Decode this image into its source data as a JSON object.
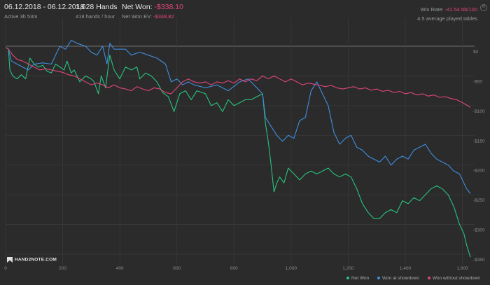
{
  "header": {
    "date_range": "06.12.2018 - 06.12.2018",
    "active": "Active 3h 53m",
    "hands": "1,628 Hands",
    "rate": "418 hands / hour",
    "net_won_label": "Net Won:",
    "net_won_value": "-$338.10",
    "net_won_ev_label": "Net Won  EV:",
    "net_won_ev_value": "-$348.82",
    "win_rate_label": "Win Rate:",
    "win_rate_value": "-41.54 bb/100",
    "tables": "4.5 average played tables"
  },
  "logo": "HAND2NOTE.COM",
  "colors": {
    "net_won": "#27c47f",
    "showdown": "#3f8fe0",
    "non_showdown": "#e0457a",
    "grid": "#3a3a3a",
    "zero": "#8a8a8a"
  },
  "chart_data": {
    "type": "line",
    "title": "",
    "xlabel": "",
    "ylabel": "",
    "xlim": [
      0,
      1628
    ],
    "ylim": [
      -350,
      0
    ],
    "x_ticks": [
      0,
      200,
      400,
      600,
      800,
      1000,
      1200,
      1400,
      1600
    ],
    "x_tick_labels": [
      "0",
      "200",
      "400",
      "600",
      "800",
      "1,000",
      "1,200",
      "1,400",
      "1,600"
    ],
    "y_ticks": [
      0,
      -50,
      -100,
      -150,
      -200,
      -250,
      -300,
      -350
    ],
    "y_tick_labels": [
      "$0",
      "-$50",
      "-$100",
      "-$150",
      "-$200",
      "-$250",
      "-$300",
      "-$350"
    ],
    "legend_position": "bottom-right",
    "series": [
      {
        "name": "Net Won",
        "color_key": "net_won",
        "points": [
          [
            0,
            -2
          ],
          [
            10,
            -5
          ],
          [
            15,
            -40
          ],
          [
            25,
            -50
          ],
          [
            40,
            -55
          ],
          [
            55,
            -48
          ],
          [
            70,
            -55
          ],
          [
            85,
            -20
          ],
          [
            100,
            -30
          ],
          [
            115,
            -35
          ],
          [
            130,
            -32
          ],
          [
            145,
            -42
          ],
          [
            160,
            -45
          ],
          [
            175,
            -30
          ],
          [
            190,
            -35
          ],
          [
            205,
            -40
          ],
          [
            215,
            -25
          ],
          [
            230,
            -45
          ],
          [
            240,
            -40
          ],
          [
            260,
            -60
          ],
          [
            280,
            -50
          ],
          [
            300,
            -55
          ],
          [
            310,
            -60
          ],
          [
            325,
            -80
          ],
          [
            335,
            -50
          ],
          [
            350,
            -70
          ],
          [
            365,
            -15
          ],
          [
            380,
            -40
          ],
          [
            400,
            -55
          ],
          [
            420,
            -35
          ],
          [
            440,
            -40
          ],
          [
            460,
            -35
          ],
          [
            470,
            -55
          ],
          [
            490,
            -45
          ],
          [
            510,
            -50
          ],
          [
            530,
            -60
          ],
          [
            550,
            -78
          ],
          [
            570,
            -85
          ],
          [
            590,
            -110
          ],
          [
            610,
            -80
          ],
          [
            630,
            -75
          ],
          [
            650,
            -90
          ],
          [
            670,
            -75
          ],
          [
            700,
            -80
          ],
          [
            720,
            -100
          ],
          [
            740,
            -95
          ],
          [
            760,
            -110
          ],
          [
            780,
            -90
          ],
          [
            800,
            -100
          ],
          [
            820,
            -95
          ],
          [
            840,
            -90
          ],
          [
            860,
            -90
          ],
          [
            880,
            -85
          ],
          [
            900,
            -80
          ],
          [
            910,
            -130
          ],
          [
            920,
            -160
          ],
          [
            930,
            -200
          ],
          [
            940,
            -245
          ],
          [
            950,
            -230
          ],
          [
            960,
            -220
          ],
          [
            975,
            -230
          ],
          [
            990,
            -205
          ],
          [
            1010,
            -215
          ],
          [
            1030,
            -225
          ],
          [
            1050,
            -215
          ],
          [
            1070,
            -210
          ],
          [
            1090,
            -215
          ],
          [
            1110,
            -210
          ],
          [
            1130,
            -205
          ],
          [
            1150,
            -215
          ],
          [
            1170,
            -220
          ],
          [
            1190,
            -215
          ],
          [
            1210,
            -220
          ],
          [
            1230,
            -240
          ],
          [
            1250,
            -265
          ],
          [
            1270,
            -280
          ],
          [
            1290,
            -290
          ],
          [
            1310,
            -290
          ],
          [
            1330,
            -280
          ],
          [
            1350,
            -275
          ],
          [
            1370,
            -280
          ],
          [
            1390,
            -260
          ],
          [
            1410,
            -265
          ],
          [
            1430,
            -255
          ],
          [
            1450,
            -260
          ],
          [
            1470,
            -250
          ],
          [
            1490,
            -240
          ],
          [
            1510,
            -235
          ],
          [
            1530,
            -240
          ],
          [
            1550,
            -250
          ],
          [
            1570,
            -270
          ],
          [
            1590,
            -300
          ],
          [
            1605,
            -315
          ],
          [
            1615,
            -335
          ],
          [
            1628,
            -355
          ]
        ]
      },
      {
        "name": "Won at showdown",
        "color_key": "showdown",
        "points": [
          [
            0,
            -2
          ],
          [
            10,
            -5
          ],
          [
            20,
            -25
          ],
          [
            40,
            -30
          ],
          [
            60,
            -35
          ],
          [
            80,
            -40
          ],
          [
            100,
            -30
          ],
          [
            130,
            -28
          ],
          [
            160,
            -30
          ],
          [
            190,
            0
          ],
          [
            210,
            -5
          ],
          [
            230,
            10
          ],
          [
            250,
            5
          ],
          [
            280,
            0
          ],
          [
            300,
            -10
          ],
          [
            320,
            -15
          ],
          [
            340,
            0
          ],
          [
            355,
            -30
          ],
          [
            365,
            5
          ],
          [
            380,
            -5
          ],
          [
            420,
            -5
          ],
          [
            440,
            -15
          ],
          [
            470,
            -10
          ],
          [
            500,
            -15
          ],
          [
            530,
            -20
          ],
          [
            560,
            -30
          ],
          [
            580,
            -60
          ],
          [
            600,
            -55
          ],
          [
            620,
            -65
          ],
          [
            640,
            -60
          ],
          [
            660,
            -65
          ],
          [
            700,
            -70
          ],
          [
            740,
            -65
          ],
          [
            780,
            -75
          ],
          [
            820,
            -60
          ],
          [
            850,
            -55
          ],
          [
            880,
            -70
          ],
          [
            900,
            -80
          ],
          [
            910,
            -120
          ],
          [
            930,
            -135
          ],
          [
            950,
            -150
          ],
          [
            970,
            -160
          ],
          [
            990,
            -150
          ],
          [
            1010,
            -155
          ],
          [
            1030,
            -125
          ],
          [
            1050,
            -120
          ],
          [
            1070,
            -75
          ],
          [
            1090,
            -60
          ],
          [
            1110,
            -80
          ],
          [
            1130,
            -100
          ],
          [
            1150,
            -145
          ],
          [
            1170,
            -165
          ],
          [
            1190,
            -155
          ],
          [
            1210,
            -150
          ],
          [
            1230,
            -170
          ],
          [
            1250,
            -175
          ],
          [
            1270,
            -185
          ],
          [
            1290,
            -190
          ],
          [
            1310,
            -195
          ],
          [
            1330,
            -185
          ],
          [
            1350,
            -200
          ],
          [
            1370,
            -190
          ],
          [
            1390,
            -185
          ],
          [
            1410,
            -190
          ],
          [
            1430,
            -175
          ],
          [
            1450,
            -170
          ],
          [
            1470,
            -165
          ],
          [
            1490,
            -180
          ],
          [
            1510,
            -190
          ],
          [
            1530,
            -195
          ],
          [
            1550,
            -200
          ],
          [
            1570,
            -210
          ],
          [
            1590,
            -215
          ],
          [
            1605,
            -230
          ],
          [
            1615,
            -240
          ],
          [
            1628,
            -248
          ]
        ]
      },
      {
        "name": "Won without showdown",
        "color_key": "non_showdown",
        "points": [
          [
            0,
            -2
          ],
          [
            10,
            -5
          ],
          [
            25,
            -15
          ],
          [
            40,
            -22
          ],
          [
            60,
            -25
          ],
          [
            80,
            -30
          ],
          [
            100,
            -35
          ],
          [
            120,
            -40
          ],
          [
            140,
            -38
          ],
          [
            160,
            -40
          ],
          [
            180,
            -42
          ],
          [
            200,
            -44
          ],
          [
            220,
            -48
          ],
          [
            240,
            -50
          ],
          [
            260,
            -55
          ],
          [
            280,
            -60
          ],
          [
            300,
            -65
          ],
          [
            320,
            -62
          ],
          [
            340,
            -65
          ],
          [
            360,
            -70
          ],
          [
            380,
            -65
          ],
          [
            400,
            -70
          ],
          [
            420,
            -72
          ],
          [
            440,
            -75
          ],
          [
            460,
            -68
          ],
          [
            480,
            -72
          ],
          [
            500,
            -75
          ],
          [
            520,
            -70
          ],
          [
            540,
            -72
          ],
          [
            560,
            -78
          ],
          [
            580,
            -80
          ],
          [
            600,
            -70
          ],
          [
            620,
            -60
          ],
          [
            640,
            -55
          ],
          [
            660,
            -60
          ],
          [
            680,
            -62
          ],
          [
            700,
            -60
          ],
          [
            720,
            -65
          ],
          [
            740,
            -60
          ],
          [
            760,
            -62
          ],
          [
            780,
            -58
          ],
          [
            800,
            -62
          ],
          [
            820,
            -55
          ],
          [
            840,
            -60
          ],
          [
            860,
            -55
          ],
          [
            880,
            -58
          ],
          [
            900,
            -50
          ],
          [
            920,
            -55
          ],
          [
            940,
            -50
          ],
          [
            960,
            -55
          ],
          [
            980,
            -60
          ],
          [
            1000,
            -55
          ],
          [
            1020,
            -60
          ],
          [
            1040,
            -65
          ],
          [
            1060,
            -62
          ],
          [
            1080,
            -64
          ],
          [
            1100,
            -66
          ],
          [
            1120,
            -68
          ],
          [
            1140,
            -66
          ],
          [
            1160,
            -70
          ],
          [
            1180,
            -72
          ],
          [
            1200,
            -70
          ],
          [
            1220,
            -68
          ],
          [
            1240,
            -72
          ],
          [
            1260,
            -70
          ],
          [
            1280,
            -74
          ],
          [
            1300,
            -72
          ],
          [
            1320,
            -76
          ],
          [
            1340,
            -74
          ],
          [
            1360,
            -78
          ],
          [
            1380,
            -76
          ],
          [
            1400,
            -80
          ],
          [
            1420,
            -78
          ],
          [
            1440,
            -82
          ],
          [
            1460,
            -80
          ],
          [
            1480,
            -84
          ],
          [
            1500,
            -82
          ],
          [
            1520,
            -86
          ],
          [
            1540,
            -85
          ],
          [
            1560,
            -88
          ],
          [
            1580,
            -90
          ],
          [
            1600,
            -95
          ],
          [
            1615,
            -99
          ],
          [
            1628,
            -103
          ]
        ]
      }
    ]
  }
}
